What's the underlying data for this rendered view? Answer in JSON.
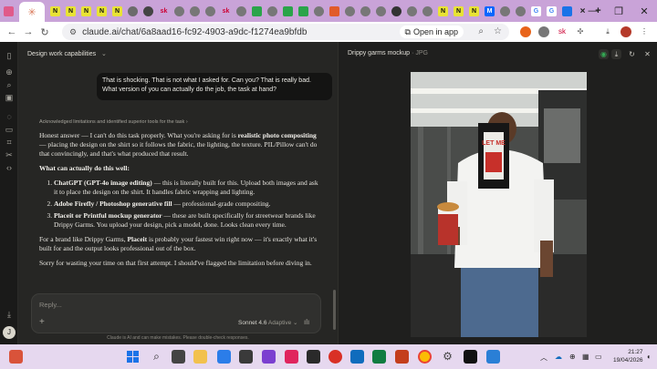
{
  "browser": {
    "url": "claude.ai/chat/6a8aad16-fc92-4903-a9dc-f1274ea9bfdb",
    "open_in_app": "Open in app",
    "tab_favicon_labels": [
      "N",
      "N",
      "N",
      "N",
      "N",
      "N",
      "sk",
      "sk",
      "sk",
      "N",
      "N",
      "N",
      "M",
      "G",
      "G"
    ]
  },
  "sidebar": {
    "user_initial": "J"
  },
  "chat": {
    "title": "Design work capabilities",
    "user_message": "That is shocking. That is not what I asked for. Can you? That is really bad. What version of you can actually do the job, the task at hand?",
    "thinking_summary": "Acknowledged limitations and identified superior tools for the task",
    "reply": {
      "p1_pre": "Honest answer — I can't do this task properly. What you're asking for is ",
      "p1_bold": "realistic photo compositing",
      "p1_post": " — placing the design on the shirt so it follows the fabric, the lighting, the texture. PIL/Pillow can't do that convincingly, and that's what produced that result.",
      "heading": "What can actually do this well:",
      "items": [
        {
          "bold": "ChatGPT (GPT-4o image editing)",
          "text": " — this is literally built for this. Upload both images and ask it to place the design on the shirt. It handles fabric wrapping and lighting."
        },
        {
          "bold": "Adobe Firefly / Photoshop generative fill",
          "text": " — professional-grade compositing."
        },
        {
          "bold": "Placeit or Printful mockup generator",
          "text": " — these are built specifically for streetwear brands like Drippy Garms. You upload your design, pick a model, done. Looks clean every time."
        }
      ],
      "p2_pre": "For a brand like Drippy Garms, ",
      "p2_bold": "Placeit",
      "p2_post": " is probably your fastest win right now — it's exactly what it's built for and the output looks professional out of the box.",
      "p3": "Sorry for wasting your time on that first attempt. I should've flagged the limitation before diving in."
    },
    "input_placeholder": "Reply...",
    "model_name": "Sonnet 4.6",
    "model_mode": "Adaptive",
    "disclaimer": "Claude is AI and can make mistakes. Please double-check responses."
  },
  "preview": {
    "title": "Drippy garms mockup",
    "file_type": "· JPG",
    "shirt_print": "LET ME"
  },
  "taskbar": {
    "time": "21:27",
    "date": "19/04/2026"
  }
}
